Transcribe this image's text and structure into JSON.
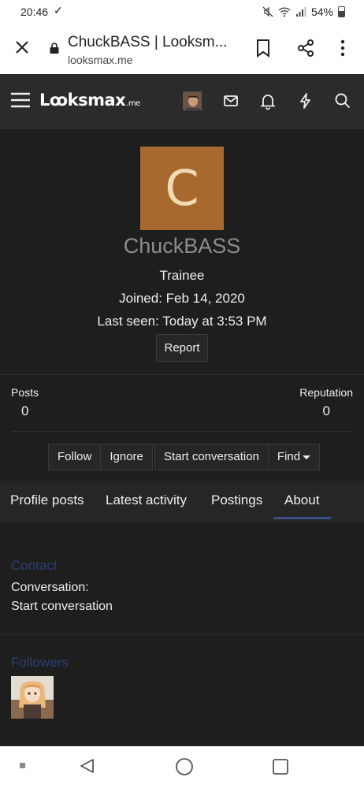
{
  "status_bar": {
    "time": "20:46",
    "battery": "54%"
  },
  "browser": {
    "title": "ChuckBASS | Looksm...",
    "url": "looksmax.me"
  },
  "site": {
    "logo": "Lꝏksmax",
    "logo_tld": ".me"
  },
  "profile": {
    "avatar_letter": "C",
    "avatar_color": "#a8692e",
    "username": "ChuckBASS",
    "user_title": "Trainee",
    "joined": "Joined: Feb 14, 2020",
    "last_seen": "Last seen: Today at 3:53 PM",
    "report_label": "Report",
    "stats": {
      "posts_label": "Posts",
      "posts_value": "0",
      "reputation_label": "Reputation",
      "reputation_value": "0"
    },
    "actions": {
      "follow": "Follow",
      "ignore": "Ignore",
      "start_conversation": "Start conversation",
      "find": "Find"
    }
  },
  "tabs": [
    {
      "label": "Profile posts"
    },
    {
      "label": "Latest activity"
    },
    {
      "label": "Postings"
    },
    {
      "label": "About",
      "active": true
    }
  ],
  "about": {
    "contact_title": "Contact",
    "conversation_label": "Conversation:",
    "conversation_link": "Start conversation",
    "followers_title": "Followers"
  },
  "colors": {
    "header_bg": "#2b2b2b",
    "accent": "#3b4f88",
    "section_title": "#2c3f73"
  },
  "icons": [
    "close-icon",
    "lock-icon",
    "bookmark-icon",
    "share-icon",
    "more-vert-icon",
    "hamburger-icon",
    "mail-icon",
    "bell-icon",
    "bolt-icon",
    "search-icon",
    "back-icon",
    "home-icon",
    "recent-apps-icon"
  ]
}
